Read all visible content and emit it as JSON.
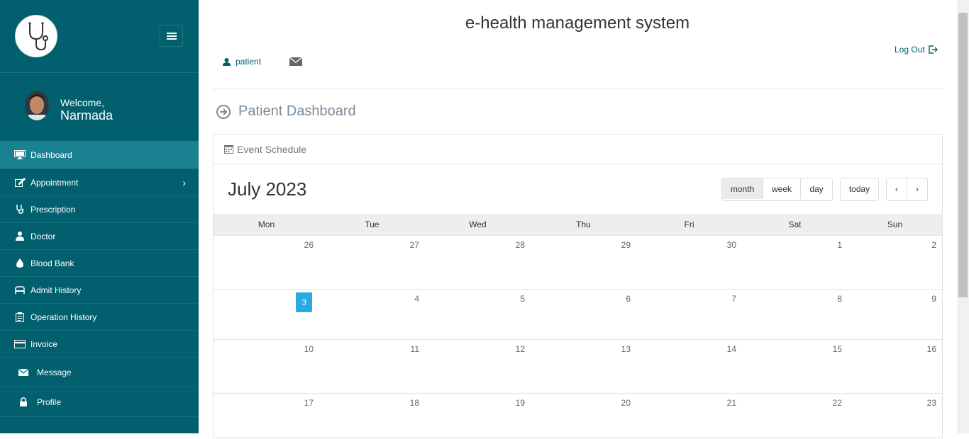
{
  "app": {
    "title": "e-health management system"
  },
  "sidebar": {
    "welcome": "Welcome,",
    "user_name": "Narmada",
    "items": [
      {
        "label": "Dashboard",
        "icon": "monitor-icon"
      },
      {
        "label": "Appointment",
        "icon": "edit-icon"
      },
      {
        "label": "Prescription",
        "icon": "stethoscope-icon"
      },
      {
        "label": "Doctor",
        "icon": "doctor-icon"
      },
      {
        "label": "Blood Bank",
        "icon": "drop-icon"
      },
      {
        "label": "Admit History",
        "icon": "hospital-bed-icon"
      },
      {
        "label": "Operation History",
        "icon": "clipboard-icon"
      },
      {
        "label": "Invoice",
        "icon": "credit-card-icon"
      },
      {
        "label": "Message",
        "icon": "envelope-icon"
      },
      {
        "label": "Profile",
        "icon": "lock-icon"
      }
    ]
  },
  "topnav": {
    "user_label": "patient",
    "logout_label": "Log Out"
  },
  "page": {
    "title": "Patient Dashboard"
  },
  "panel": {
    "title": "Event Schedule"
  },
  "calendar": {
    "month_title": "July 2023",
    "view_buttons": [
      "month",
      "week",
      "day"
    ],
    "today_label": "today",
    "prev_label": "‹",
    "next_label": "›",
    "weekdays": [
      "Mon",
      "Tue",
      "Wed",
      "Thu",
      "Fri",
      "Sat",
      "Sun"
    ],
    "weeks": [
      [
        "26",
        "27",
        "28",
        "29",
        "30",
        "1",
        "2"
      ],
      [
        "3",
        "4",
        "5",
        "6",
        "7",
        "8",
        "9"
      ],
      [
        "10",
        "11",
        "12",
        "13",
        "14",
        "15",
        "16"
      ],
      [
        "17",
        "18",
        "19",
        "20",
        "21",
        "22",
        "23"
      ]
    ],
    "today_date": "3",
    "colors": {
      "today": "#27a9e1",
      "sidebar": "#02606e"
    }
  }
}
